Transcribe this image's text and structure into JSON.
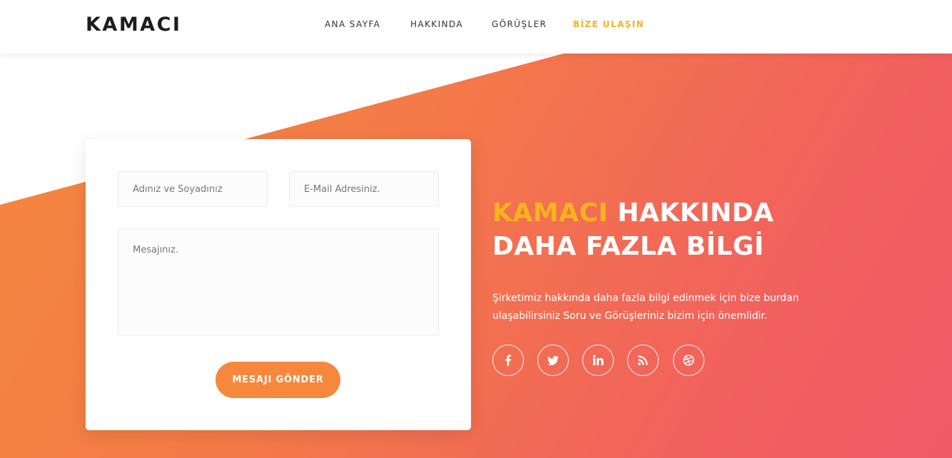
{
  "header": {
    "logo": "KAMACI",
    "nav": [
      {
        "label": "ANA SAYFA"
      },
      {
        "label": "HAKKINDA"
      },
      {
        "label": "GÖRÜŞLER"
      },
      {
        "label": "BİZE ULAŞIN",
        "active": true
      }
    ]
  },
  "form": {
    "name_placeholder": "Adınız ve Soyadınız",
    "email_placeholder": "E-Mail Adresiniz.",
    "message_placeholder": "Mesajınız.",
    "submit_label": "MESAJI GÖNDER"
  },
  "info": {
    "title_brand": "KAMACI",
    "title_rest": " HAKKINDA",
    "title_line2": "DAHA FAZLA BİLGİ",
    "description_line1": "Şirketimiz hakkında daha fazla bilgi edinmek için bize burdan",
    "description_line2": "ulaşabilirsiniz Soru ve Görüşleriniz bizim için önemlidir."
  },
  "social": [
    "facebook-icon",
    "twitter-icon",
    "linkedin-icon",
    "rss-icon",
    "dribbble-icon"
  ],
  "colors": {
    "accent": "#f8b21d",
    "button": "#f5883d",
    "gradient_start": "#f5883d",
    "gradient_end": "#f05a67"
  }
}
